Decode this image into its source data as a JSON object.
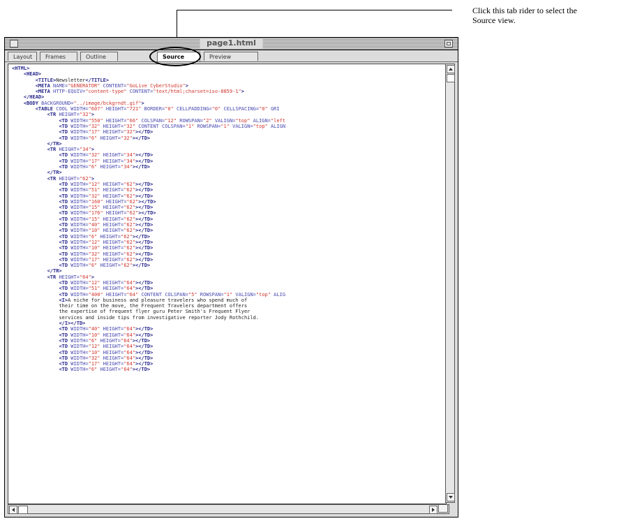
{
  "annotation": {
    "line1": "Click this tab rider to select the",
    "line2": "Source view."
  },
  "window": {
    "title": "page1.html",
    "tabs": [
      {
        "label": "Layout",
        "active": false
      },
      {
        "label": "Frames",
        "active": false
      },
      {
        "label": "Outline",
        "active": false
      },
      {
        "label": "Source",
        "active": true
      },
      {
        "label": "Preview",
        "active": false
      }
    ]
  },
  "source_lines": [
    [
      [
        "tag",
        "<HTML>"
      ]
    ],
    [
      [
        "pad",
        "    "
      ],
      [
        "tag",
        "<HEAD>"
      ]
    ],
    [
      [
        "pad",
        "        "
      ],
      [
        "tag",
        "<TITLE>"
      ],
      [
        "txt",
        "Newsletter"
      ],
      [
        "tag",
        "</TITLE>"
      ]
    ],
    [
      [
        "pad",
        "        "
      ],
      [
        "tag",
        "<META"
      ],
      [
        "attr",
        " NAME="
      ],
      [
        "val",
        "\"GENERATOR\""
      ],
      [
        "attr",
        " CONTENT="
      ],
      [
        "val",
        "\"GoLive CyberStudio\""
      ],
      [
        "tag",
        ">"
      ]
    ],
    [
      [
        "pad",
        "        "
      ],
      [
        "tag",
        "<META"
      ],
      [
        "attr",
        " HTTP-EQUIV="
      ],
      [
        "val",
        "\"content-type\""
      ],
      [
        "attr",
        " CONTENT="
      ],
      [
        "val",
        "\"text/html;charset=iso-8859-1\""
      ],
      [
        "tag",
        ">"
      ]
    ],
    [
      [
        "pad",
        "    "
      ],
      [
        "tag",
        "</HEAD>"
      ]
    ],
    [
      [
        "pad",
        "    "
      ],
      [
        "tag",
        "<BODY"
      ],
      [
        "attr",
        " BACKGROUND="
      ],
      [
        "val",
        "\"../image/bckgrndt.gif\""
      ],
      [
        "tag",
        ">"
      ]
    ],
    [
      [
        "pad",
        "        "
      ],
      [
        "tag",
        "<TABLE"
      ],
      [
        "attr",
        " COOL WIDTH="
      ],
      [
        "val",
        "\"607\""
      ],
      [
        "attr",
        " HEIGHT="
      ],
      [
        "val",
        "\"721\""
      ],
      [
        "attr",
        " BORDER="
      ],
      [
        "val",
        "\"0\""
      ],
      [
        "attr",
        " CELLPADDING="
      ],
      [
        "val",
        "\"0\""
      ],
      [
        "attr",
        " CELLSPACING="
      ],
      [
        "val",
        "\"0\""
      ],
      [
        "attr",
        " GRI"
      ]
    ],
    [
      [
        "pad",
        "            "
      ],
      [
        "tag",
        "<TR"
      ],
      [
        "attr",
        " HEIGHT="
      ],
      [
        "val",
        "\"32\""
      ],
      [
        "tag",
        ">"
      ]
    ],
    [
      [
        "pad",
        "                "
      ],
      [
        "tag",
        "<TD"
      ],
      [
        "attr",
        " WIDTH="
      ],
      [
        "val",
        "\"550\""
      ],
      [
        "attr",
        " HEIGHT="
      ],
      [
        "val",
        "\"66\""
      ],
      [
        "attr",
        " COLSPAN="
      ],
      [
        "val",
        "\"12\""
      ],
      [
        "attr",
        " ROWSPAN="
      ],
      [
        "val",
        "\"2\""
      ],
      [
        "attr",
        " VALIGN="
      ],
      [
        "val",
        "\"top\""
      ],
      [
        "attr",
        " ALIGN="
      ],
      [
        "val",
        "\"left"
      ]
    ],
    [
      [
        "pad",
        "                "
      ],
      [
        "tag",
        "<TD"
      ],
      [
        "attr",
        " WIDTH="
      ],
      [
        "val",
        "\"32\""
      ],
      [
        "attr",
        " HEIGHT="
      ],
      [
        "val",
        "\"32\""
      ],
      [
        "attr",
        " CONTENT COLSPAN="
      ],
      [
        "val",
        "\"1\""
      ],
      [
        "attr",
        " ROWSPAN="
      ],
      [
        "val",
        "\"1\""
      ],
      [
        "attr",
        " VALIGN="
      ],
      [
        "val",
        "\"top\""
      ],
      [
        "attr",
        " ALIGN"
      ]
    ],
    [
      [
        "pad",
        "                "
      ],
      [
        "tag",
        "<TD"
      ],
      [
        "attr",
        " WIDTH="
      ],
      [
        "val",
        "\"17\""
      ],
      [
        "attr",
        " HEIGHT="
      ],
      [
        "val",
        "\"32\""
      ],
      [
        "tag",
        "></TD>"
      ]
    ],
    [
      [
        "pad",
        "                "
      ],
      [
        "tag",
        "<TD"
      ],
      [
        "attr",
        " WIDTH="
      ],
      [
        "val",
        "\"6\""
      ],
      [
        "attr",
        " HEIGHT="
      ],
      [
        "val",
        "\"32\""
      ],
      [
        "tag",
        "></TD>"
      ]
    ],
    [
      [
        "pad",
        "            "
      ],
      [
        "tag",
        "</TR>"
      ]
    ],
    [
      [
        "pad",
        "            "
      ],
      [
        "tag",
        "<TR"
      ],
      [
        "attr",
        " HEIGHT="
      ],
      [
        "val",
        "\"34\""
      ],
      [
        "tag",
        ">"
      ]
    ],
    [
      [
        "pad",
        "                "
      ],
      [
        "tag",
        "<TD"
      ],
      [
        "attr",
        " WIDTH="
      ],
      [
        "val",
        "\"32\""
      ],
      [
        "attr",
        " HEIGHT="
      ],
      [
        "val",
        "\"34\""
      ],
      [
        "tag",
        "></TD>"
      ]
    ],
    [
      [
        "pad",
        "                "
      ],
      [
        "tag",
        "<TD"
      ],
      [
        "attr",
        " WIDTH="
      ],
      [
        "val",
        "\"17\""
      ],
      [
        "attr",
        " HEIGHT="
      ],
      [
        "val",
        "\"34\""
      ],
      [
        "tag",
        "></TD>"
      ]
    ],
    [
      [
        "pad",
        "                "
      ],
      [
        "tag",
        "<TD"
      ],
      [
        "attr",
        " WIDTH="
      ],
      [
        "val",
        "\"6\""
      ],
      [
        "attr",
        " HEIGHT="
      ],
      [
        "val",
        "\"34\""
      ],
      [
        "tag",
        "></TD>"
      ]
    ],
    [
      [
        "pad",
        "            "
      ],
      [
        "tag",
        "</TR>"
      ]
    ],
    [
      [
        "pad",
        "            "
      ],
      [
        "tag",
        "<TR"
      ],
      [
        "attr",
        " HEIGHT="
      ],
      [
        "val",
        "\"62\""
      ],
      [
        "tag",
        ">"
      ]
    ],
    [
      [
        "pad",
        "                "
      ],
      [
        "tag",
        "<TD"
      ],
      [
        "attr",
        " WIDTH="
      ],
      [
        "val",
        "\"12\""
      ],
      [
        "attr",
        " HEIGHT="
      ],
      [
        "val",
        "\"62\""
      ],
      [
        "tag",
        "></TD>"
      ]
    ],
    [
      [
        "pad",
        "                "
      ],
      [
        "tag",
        "<TD"
      ],
      [
        "attr",
        " WIDTH="
      ],
      [
        "val",
        "\"51\""
      ],
      [
        "attr",
        " HEIGHT="
      ],
      [
        "val",
        "\"62\""
      ],
      [
        "tag",
        "></TD>"
      ]
    ],
    [
      [
        "pad",
        "                "
      ],
      [
        "tag",
        "<TD"
      ],
      [
        "attr",
        " WIDTH="
      ],
      [
        "val",
        "\"32\""
      ],
      [
        "attr",
        " HEIGHT="
      ],
      [
        "val",
        "\"62\""
      ],
      [
        "tag",
        "></TD>"
      ]
    ],
    [
      [
        "pad",
        "                "
      ],
      [
        "tag",
        "<TD"
      ],
      [
        "attr",
        " WIDTH="
      ],
      [
        "val",
        "\"160\""
      ],
      [
        "attr",
        " HEIGHT="
      ],
      [
        "val",
        "\"62\""
      ],
      [
        "tag",
        "></TD>"
      ]
    ],
    [
      [
        "pad",
        "                "
      ],
      [
        "tag",
        "<TD"
      ],
      [
        "attr",
        " WIDTH="
      ],
      [
        "val",
        "\"15\""
      ],
      [
        "attr",
        " HEIGHT="
      ],
      [
        "val",
        "\"62\""
      ],
      [
        "tag",
        "></TD>"
      ]
    ],
    [
      [
        "pad",
        "                "
      ],
      [
        "tag",
        "<TD"
      ],
      [
        "attr",
        " WIDTH="
      ],
      [
        "val",
        "\"176\""
      ],
      [
        "attr",
        " HEIGHT="
      ],
      [
        "val",
        "\"62\""
      ],
      [
        "tag",
        "></TD>"
      ]
    ],
    [
      [
        "pad",
        "                "
      ],
      [
        "tag",
        "<TD"
      ],
      [
        "attr",
        " WIDTH="
      ],
      [
        "val",
        "\"15\""
      ],
      [
        "attr",
        " HEIGHT="
      ],
      [
        "val",
        "\"62\""
      ],
      [
        "tag",
        "></TD>"
      ]
    ],
    [
      [
        "pad",
        "                "
      ],
      [
        "tag",
        "<TD"
      ],
      [
        "attr",
        " WIDTH="
      ],
      [
        "val",
        "\"40\""
      ],
      [
        "attr",
        " HEIGHT="
      ],
      [
        "val",
        "\"62\""
      ],
      [
        "tag",
        "></TD>"
      ]
    ],
    [
      [
        "pad",
        "                "
      ],
      [
        "tag",
        "<TD"
      ],
      [
        "attr",
        " WIDTH="
      ],
      [
        "val",
        "\"10\""
      ],
      [
        "attr",
        " HEIGHT="
      ],
      [
        "val",
        "\"62\""
      ],
      [
        "tag",
        "></TD>"
      ]
    ],
    [
      [
        "pad",
        "                "
      ],
      [
        "tag",
        "<TD"
      ],
      [
        "attr",
        " WIDTH="
      ],
      [
        "val",
        "\"6\""
      ],
      [
        "attr",
        " HEIGHT="
      ],
      [
        "val",
        "\"62\""
      ],
      [
        "tag",
        "></TD>"
      ]
    ],
    [
      [
        "pad",
        "                "
      ],
      [
        "tag",
        "<TD"
      ],
      [
        "attr",
        " WIDTH="
      ],
      [
        "val",
        "\"12\""
      ],
      [
        "attr",
        " HEIGHT="
      ],
      [
        "val",
        "\"62\""
      ],
      [
        "tag",
        "></TD>"
      ]
    ],
    [
      [
        "pad",
        "                "
      ],
      [
        "tag",
        "<TD"
      ],
      [
        "attr",
        " WIDTH="
      ],
      [
        "val",
        "\"10\""
      ],
      [
        "attr",
        " HEIGHT="
      ],
      [
        "val",
        "\"62\""
      ],
      [
        "tag",
        "></TD>"
      ]
    ],
    [
      [
        "pad",
        "                "
      ],
      [
        "tag",
        "<TD"
      ],
      [
        "attr",
        " WIDTH="
      ],
      [
        "val",
        "\"32\""
      ],
      [
        "attr",
        " HEIGHT="
      ],
      [
        "val",
        "\"62\""
      ],
      [
        "tag",
        "></TD>"
      ]
    ],
    [
      [
        "pad",
        "                "
      ],
      [
        "tag",
        "<TD"
      ],
      [
        "attr",
        " WIDTH="
      ],
      [
        "val",
        "\"17\""
      ],
      [
        "attr",
        " HEIGHT="
      ],
      [
        "val",
        "\"62\""
      ],
      [
        "tag",
        "></TD>"
      ]
    ],
    [
      [
        "pad",
        "                "
      ],
      [
        "tag",
        "<TD"
      ],
      [
        "attr",
        " WIDTH="
      ],
      [
        "val",
        "\"6\""
      ],
      [
        "attr",
        " HEIGHT="
      ],
      [
        "val",
        "\"62\""
      ],
      [
        "tag",
        "></TD>"
      ]
    ],
    [
      [
        "pad",
        "            "
      ],
      [
        "tag",
        "</TR>"
      ]
    ],
    [
      [
        "pad",
        "            "
      ],
      [
        "tag",
        "<TR"
      ],
      [
        "attr",
        " HEIGHT="
      ],
      [
        "val",
        "\"64\""
      ],
      [
        "tag",
        ">"
      ]
    ],
    [
      [
        "pad",
        "                "
      ],
      [
        "tag",
        "<TD"
      ],
      [
        "attr",
        " WIDTH="
      ],
      [
        "val",
        "\"12\""
      ],
      [
        "attr",
        " HEIGHT="
      ],
      [
        "val",
        "\"64\""
      ],
      [
        "tag",
        "></TD>"
      ]
    ],
    [
      [
        "pad",
        "                "
      ],
      [
        "tag",
        "<TD"
      ],
      [
        "attr",
        " WIDTH="
      ],
      [
        "val",
        "\"51\""
      ],
      [
        "attr",
        " HEIGHT="
      ],
      [
        "val",
        "\"64\""
      ],
      [
        "tag",
        "></TD>"
      ]
    ],
    [
      [
        "pad",
        "                "
      ],
      [
        "tag",
        "<TD"
      ],
      [
        "attr",
        " WIDTH="
      ],
      [
        "val",
        "\"400\""
      ],
      [
        "attr",
        " HEIGHT="
      ],
      [
        "val",
        "\"64\""
      ],
      [
        "attr",
        " CONTENT COLSPAN="
      ],
      [
        "val",
        "\"5\""
      ],
      [
        "attr",
        " ROWSPAN="
      ],
      [
        "val",
        "\"1\""
      ],
      [
        "attr",
        " VALIGN="
      ],
      [
        "val",
        "\"top\""
      ],
      [
        "attr",
        " ALIG"
      ]
    ],
    [
      [
        "pad",
        "                "
      ],
      [
        "tag",
        "<I>"
      ],
      [
        "txt",
        "A niche for business and pleasure travelers who spend much of"
      ]
    ],
    [
      [
        "pad",
        "                "
      ],
      [
        "txt",
        "their time on the move, the Frequent Travelers department offers"
      ]
    ],
    [
      [
        "pad",
        "                "
      ],
      [
        "txt",
        "the expertise of frequent flyer guru Peter Smith's Frequent Flyer"
      ]
    ],
    [
      [
        "pad",
        "                "
      ],
      [
        "txt",
        "services and inside tips from investigative reporter Jody Rothchild."
      ]
    ],
    [
      [
        "pad",
        "                "
      ],
      [
        "tag",
        "</I></TD>"
      ]
    ],
    [
      [
        "pad",
        "                "
      ],
      [
        "tag",
        "<TD"
      ],
      [
        "attr",
        " WIDTH="
      ],
      [
        "val",
        "\"40\""
      ],
      [
        "attr",
        " HEIGHT="
      ],
      [
        "val",
        "\"64\""
      ],
      [
        "tag",
        "></TD>"
      ]
    ],
    [
      [
        "pad",
        "                "
      ],
      [
        "tag",
        "<TD"
      ],
      [
        "attr",
        " WIDTH="
      ],
      [
        "val",
        "\"10\""
      ],
      [
        "attr",
        " HEIGHT="
      ],
      [
        "val",
        "\"64\""
      ],
      [
        "tag",
        "></TD>"
      ]
    ],
    [
      [
        "pad",
        "                "
      ],
      [
        "tag",
        "<TD"
      ],
      [
        "attr",
        " WIDTH="
      ],
      [
        "val",
        "\"6\""
      ],
      [
        "attr",
        " HEIGHT="
      ],
      [
        "val",
        "\"64\""
      ],
      [
        "tag",
        "></TD>"
      ]
    ],
    [
      [
        "pad",
        "                "
      ],
      [
        "tag",
        "<TD"
      ],
      [
        "attr",
        " WIDTH="
      ],
      [
        "val",
        "\"12\""
      ],
      [
        "attr",
        " HEIGHT="
      ],
      [
        "val",
        "\"64\""
      ],
      [
        "tag",
        "></TD>"
      ]
    ],
    [
      [
        "pad",
        "                "
      ],
      [
        "tag",
        "<TD"
      ],
      [
        "attr",
        " WIDTH="
      ],
      [
        "val",
        "\"10\""
      ],
      [
        "attr",
        " HEIGHT="
      ],
      [
        "val",
        "\"64\""
      ],
      [
        "tag",
        "></TD>"
      ]
    ],
    [
      [
        "pad",
        "                "
      ],
      [
        "tag",
        "<TD"
      ],
      [
        "attr",
        " WIDTH="
      ],
      [
        "val",
        "\"32\""
      ],
      [
        "attr",
        " HEIGHT="
      ],
      [
        "val",
        "\"64\""
      ],
      [
        "tag",
        "></TD>"
      ]
    ],
    [
      [
        "pad",
        "                "
      ],
      [
        "tag",
        "<TD"
      ],
      [
        "attr",
        " WIDTH="
      ],
      [
        "val",
        "\"17\""
      ],
      [
        "attr",
        " HEIGHT="
      ],
      [
        "val",
        "\"64\""
      ],
      [
        "tag",
        "></TD>"
      ]
    ],
    [
      [
        "pad",
        "                "
      ],
      [
        "tag",
        "<TD"
      ],
      [
        "attr",
        " WIDTH="
      ],
      [
        "val",
        "\"6\""
      ],
      [
        "attr",
        " HEIGHT="
      ],
      [
        "val",
        "\"64\""
      ],
      [
        "tag",
        "></TD>"
      ]
    ]
  ],
  "icons": {
    "close": "close-box-icon",
    "zoom": "zoom-box-icon",
    "scroll_up": "arrow-up-icon",
    "scroll_down": "arrow-down-icon",
    "scroll_left": "arrow-left-icon",
    "scroll_right": "arrow-right-icon",
    "grow": "grow-box-icon"
  },
  "colors": {
    "tag": "#24248a",
    "attribute": "#4848b0",
    "value": "#d0342c",
    "text": "#222222"
  }
}
